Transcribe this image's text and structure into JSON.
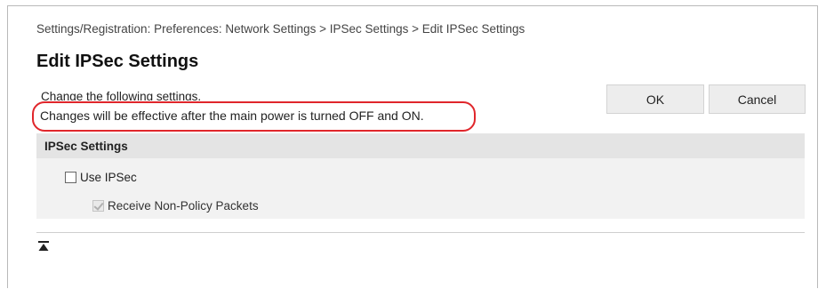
{
  "breadcrumb": "Settings/Registration: Preferences: Network Settings > IPSec Settings > Edit IPSec Settings",
  "page_title": "Edit IPSec Settings",
  "notes": {
    "line1": "Change the following settings.",
    "line2": "Changes will be effective after the main power is turned OFF and ON."
  },
  "buttons": {
    "ok": "OK",
    "cancel": "Cancel"
  },
  "section": {
    "title": "IPSec Settings",
    "use_ipsec": {
      "label": "Use IPSec",
      "checked": false
    },
    "receive_non_policy": {
      "label": "Receive Non-Policy Packets",
      "checked": true,
      "disabled": true
    }
  },
  "colors": {
    "highlight": "#e0262b",
    "section_header_bg": "#e4e4e4",
    "section_bg": "#f2f2f2",
    "button_bg": "#ededed"
  },
  "icons": {
    "to_top": "scroll-to-top-icon"
  }
}
